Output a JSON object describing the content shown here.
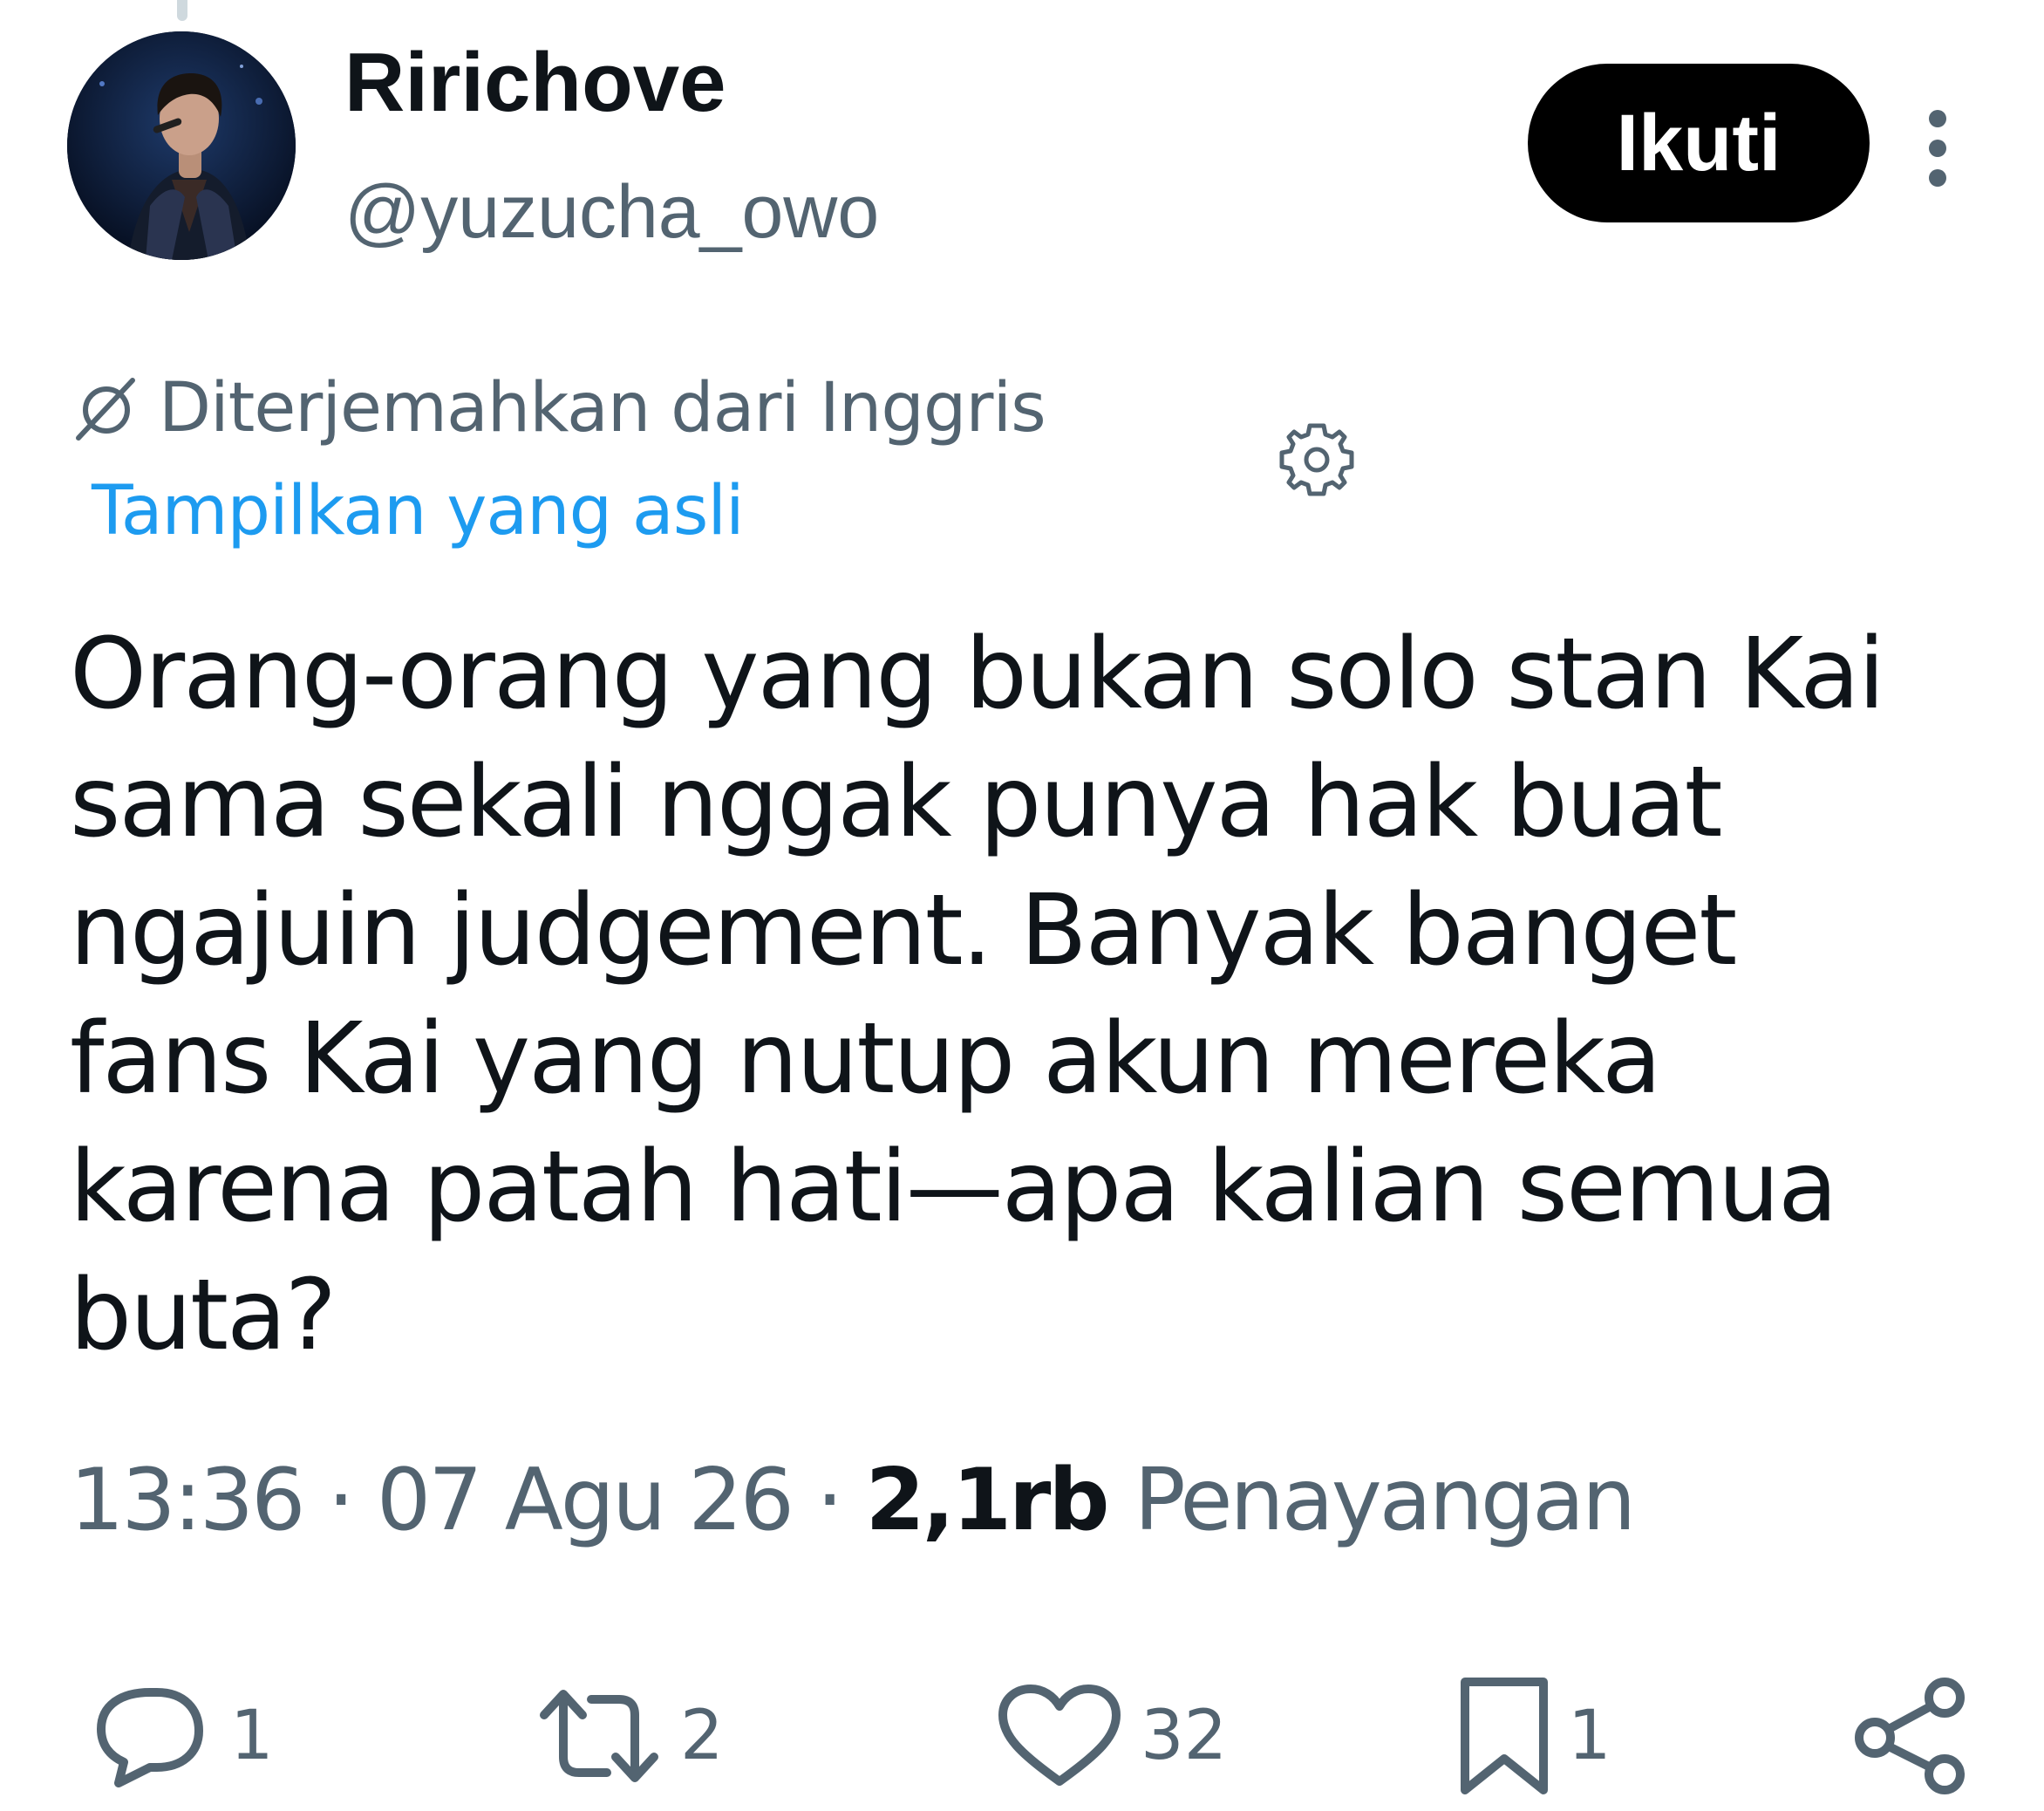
{
  "author": {
    "display_name": "Ririchove",
    "handle": "@yuzucha_owo",
    "avatar_icon": "profile-photo"
  },
  "follow_button": {
    "label": "Ikuti"
  },
  "more_icon": "more-vertical-icon",
  "translation": {
    "label": "Diterjemahkan dari Inggris",
    "show_original": "Tampilkan yang asli",
    "settings_icon": "gear-icon"
  },
  "tweet": {
    "lines": [
      "Orang-orang yang bukan solo stan Kai",
      "sama sekali nggak punya hak buat",
      "ngajuin judgement. Banyak banget",
      "fans Kai yang nutup akun mereka",
      "karena patah hati—apa kalian semua",
      "buta?"
    ]
  },
  "meta": {
    "time": "13:36",
    "separator": "·",
    "date": "07 Agu 26",
    "views_count": "2,1rb",
    "views_label": "Penayangan"
  },
  "actions": {
    "reply": {
      "icon": "reply-icon",
      "count": "1"
    },
    "retweet": {
      "icon": "retweet-icon",
      "count": "2"
    },
    "like": {
      "icon": "heart-icon",
      "count": "32"
    },
    "bookmark": {
      "icon": "bookmark-icon",
      "count": "1"
    },
    "share": {
      "icon": "share-icon"
    }
  },
  "colors": {
    "text_primary": "#0f1419",
    "text_secondary": "#536471",
    "link": "#1d9bf0",
    "follow_bg": "#000000",
    "follow_text": "#ffffff"
  }
}
